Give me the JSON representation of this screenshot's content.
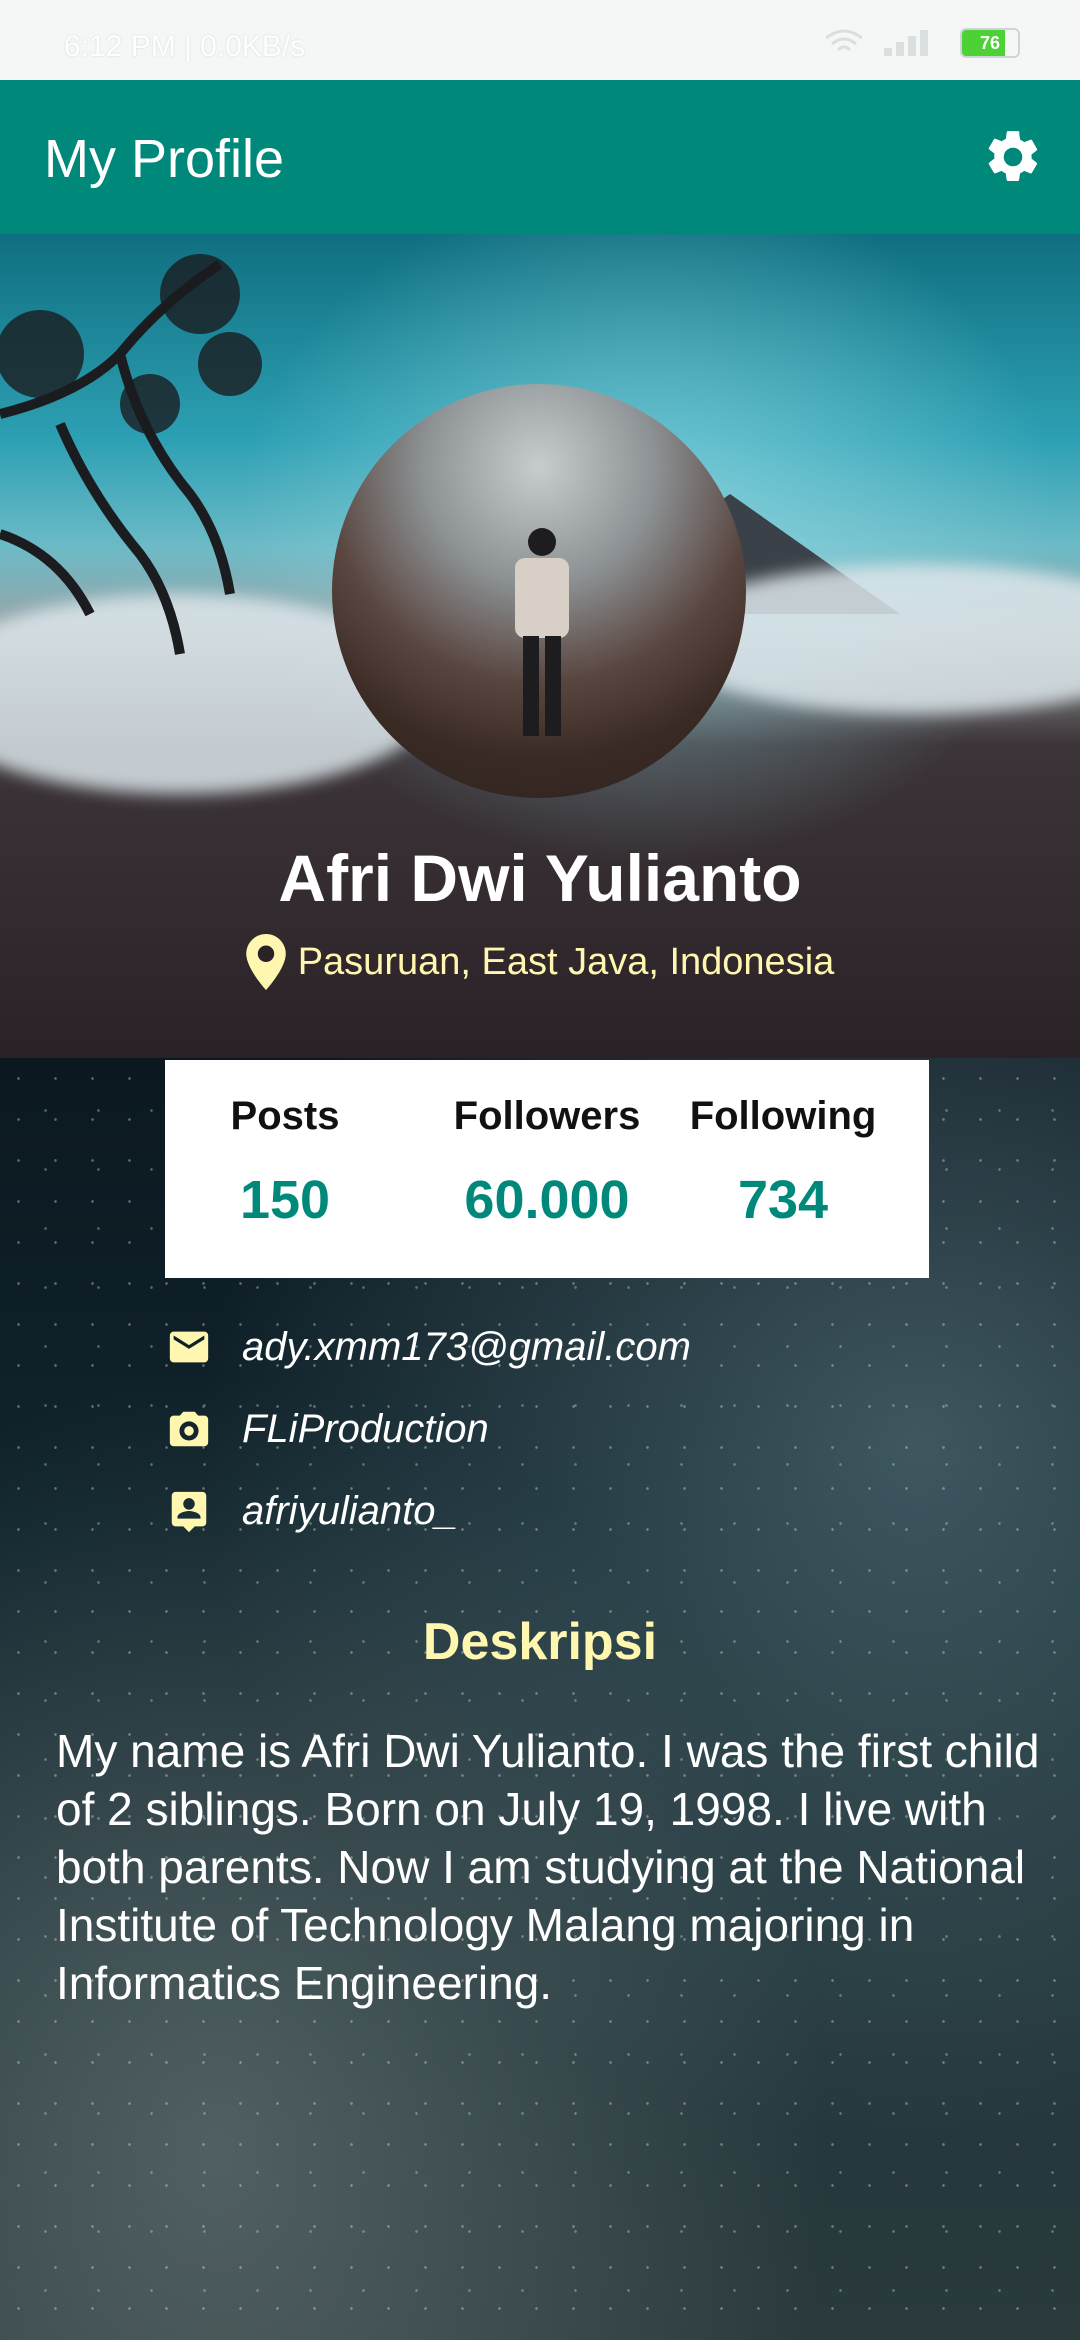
{
  "status_bar": {
    "time_and_speed": "6:12 PM | 0.0KB/s",
    "battery": "76",
    "battery_level_percent": 76
  },
  "app_bar": {
    "title": "My Profile",
    "settings_icon": "gear-icon"
  },
  "profile": {
    "name": "Afri Dwi Yulianto",
    "location": "Pasuruan, East Java, Indonesia",
    "location_icon": "map-pin-icon"
  },
  "stats": [
    {
      "label": "Posts",
      "value": "150"
    },
    {
      "label": "Followers",
      "value": "60.000"
    },
    {
      "label": "Following",
      "value": "734"
    }
  ],
  "contacts": [
    {
      "icon": "email-icon",
      "text": "ady.xmm173@gmail.com"
    },
    {
      "icon": "camera-icon",
      "text": "FLiProduction"
    },
    {
      "icon": "contact-badge-icon",
      "text": "afriyulianto_"
    }
  ],
  "description": {
    "title": "Deskripsi",
    "text": "My name is Afri Dwi Yulianto. I was the first child of 2 siblings. Born on July 19, 1998. I live with both parents. Now I am studying at the National Institute of Technology Malang majoring in Informatics Engineering."
  },
  "colors": {
    "primary": "#00897b",
    "accent_yellow": "#fff7b0"
  }
}
